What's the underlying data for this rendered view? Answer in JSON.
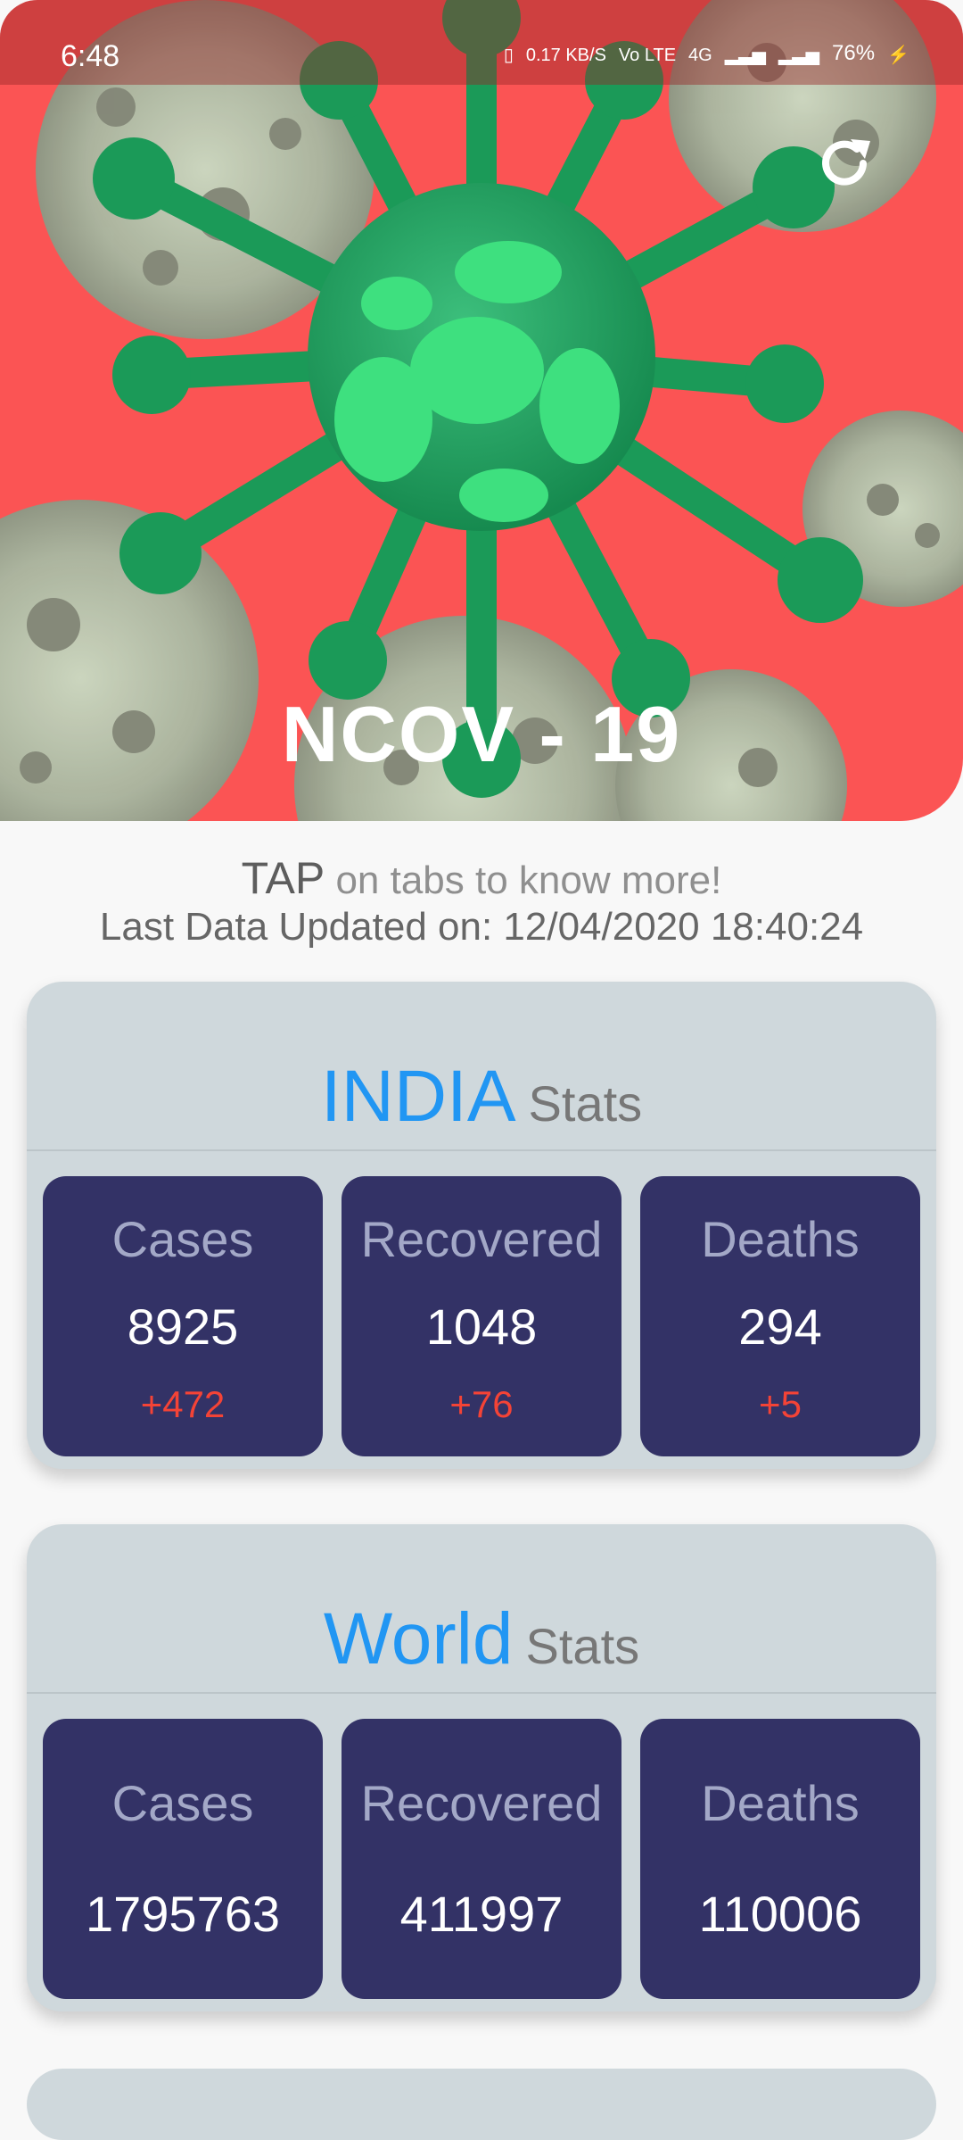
{
  "status_bar": {
    "time": "6:48",
    "speed_value": "0.17",
    "speed_unit": "KB/S",
    "volte": "Vo LTE",
    "network": "4G",
    "battery": "76%"
  },
  "header": {
    "title": "NCOV - 19",
    "background_color": "#fb5454",
    "refresh_icon": "refresh-icon"
  },
  "info": {
    "tap_word": "TAP",
    "tap_rest": "on tabs to know more!",
    "last_updated": "Last Data Updated on: 12/04/2020 18:40:24"
  },
  "india": {
    "title": "INDIA",
    "subtitle": "Stats",
    "cases": {
      "label": "Cases",
      "value": "8925",
      "delta": "+472"
    },
    "recovered": {
      "label": "Recovered",
      "value": "1048",
      "delta": "+76"
    },
    "deaths": {
      "label": "Deaths",
      "value": "294",
      "delta": "+5"
    }
  },
  "world": {
    "title": "World",
    "subtitle": "Stats",
    "cases": {
      "label": "Cases",
      "value": "1795763"
    },
    "recovered": {
      "label": "Recovered",
      "value": "411997"
    },
    "deaths": {
      "label": "Deaths",
      "value": "110006"
    }
  },
  "colors": {
    "accent": "#2196f3",
    "tile_bg": "#333266",
    "card_bg": "#cfd8dc",
    "delta": "#f44336"
  }
}
